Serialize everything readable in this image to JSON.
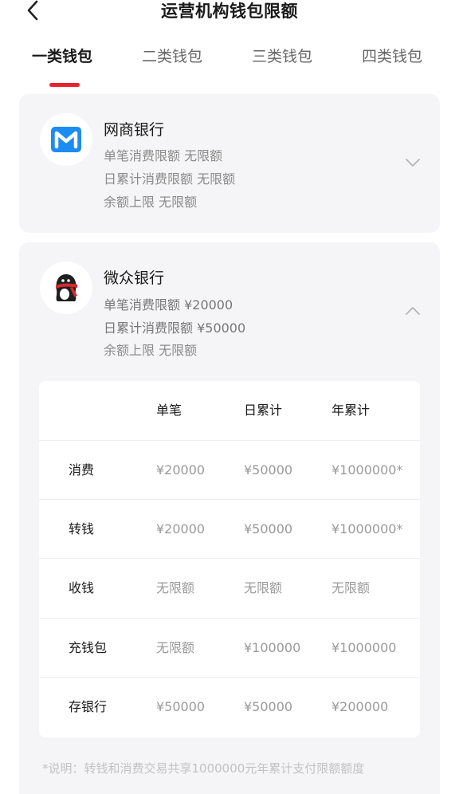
{
  "header": {
    "title": "运营机构钱包限额"
  },
  "tabs": [
    {
      "label": "一类钱包"
    },
    {
      "label": "二类钱包"
    },
    {
      "label": "三类钱包"
    },
    {
      "label": "四类钱包"
    }
  ],
  "banks": [
    {
      "name": "网商银行",
      "limits": [
        "单笔消费限额 无限额",
        "日累计消费限额 无限额",
        "余额上限 无限额"
      ]
    },
    {
      "name": "微众银行",
      "limits": [
        "单笔消费限额 ¥20000",
        "日累计消费限额 ¥50000",
        "余额上限 无限额"
      ]
    }
  ],
  "table": {
    "headers": [
      "单笔",
      "日累计",
      "年累计"
    ],
    "rows": [
      {
        "label": "消费",
        "values": [
          "¥20000",
          "¥50000",
          "¥1000000*"
        ]
      },
      {
        "label": "转钱",
        "values": [
          "¥20000",
          "¥50000",
          "¥1000000*"
        ]
      },
      {
        "label": "收钱",
        "values": [
          "无限额",
          "无限额",
          "无限额"
        ]
      },
      {
        "label": "充钱包",
        "values": [
          "无限额",
          "¥100000",
          "¥1000000"
        ]
      },
      {
        "label": "存银行",
        "values": [
          "¥50000",
          "¥50000",
          "¥200000"
        ]
      }
    ]
  },
  "footnote": "*说明：转钱和消费交易共享1000000元年累计支付限额额度",
  "colors": {
    "accent": "#e8232f",
    "mybank_blue": "#1c8cf2",
    "card_bg": "#f5f5f7"
  },
  "icons": {
    "back": "chevron-left-icon",
    "expand": "chevron-down-icon",
    "collapse": "chevron-up-icon"
  }
}
